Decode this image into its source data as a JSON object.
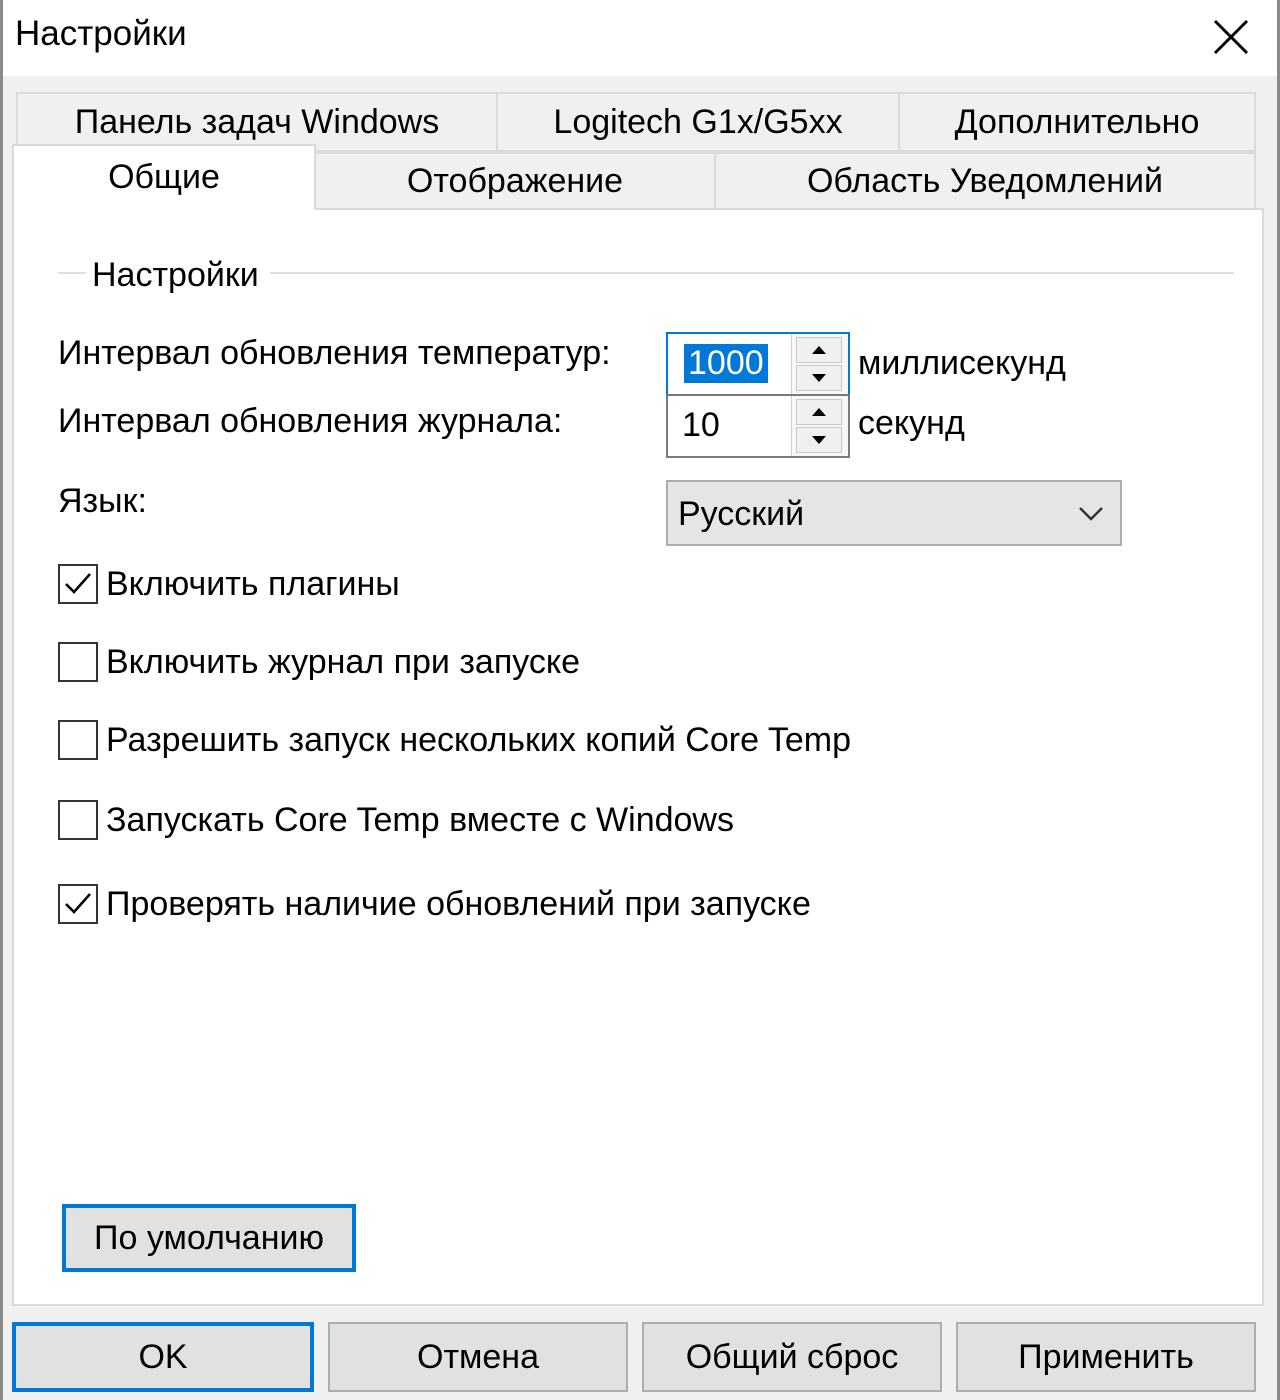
{
  "window": {
    "title": "Настройки",
    "close_label": "Закрыть"
  },
  "tabs_row_top": [
    {
      "label": "Панель задач Windows"
    },
    {
      "label": "Logitech G1x/G5xx"
    },
    {
      "label": "Дополнительно"
    }
  ],
  "tabs_row_bottom": [
    {
      "label": "Общие",
      "active": true
    },
    {
      "label": "Отображение",
      "active": false
    },
    {
      "label": "Область Уведомлений",
      "active": false
    }
  ],
  "settings_group": {
    "title": "Настройки",
    "temp_interval": {
      "label": "Интервал обновления температур:",
      "value": "1000",
      "unit": "миллисекунд"
    },
    "log_interval": {
      "label": "Интервал обновления журнала:",
      "value": "10",
      "unit": "секунд"
    },
    "language": {
      "label": "Язык:",
      "value": "Русский"
    },
    "checkboxes": [
      {
        "label": "Включить плагины",
        "checked": true
      },
      {
        "label": "Включить журнал при запуске",
        "checked": false
      },
      {
        "label": "Разрешить запуск нескольких копий Core Temp",
        "checked": false
      },
      {
        "label": "Запускать Core Temp вместе с Windows",
        "checked": false
      },
      {
        "label": "Проверять наличие обновлений при запуске",
        "checked": true
      }
    ],
    "defaults_button": "По умолчанию"
  },
  "footer": {
    "ok": "OK",
    "cancel": "Отмена",
    "reset": "Общий сброс",
    "apply": "Применить"
  },
  "colors": {
    "focus_blue": "#0078d7",
    "window_bg": "#f0f0f0",
    "page_bg": "#ffffff"
  }
}
